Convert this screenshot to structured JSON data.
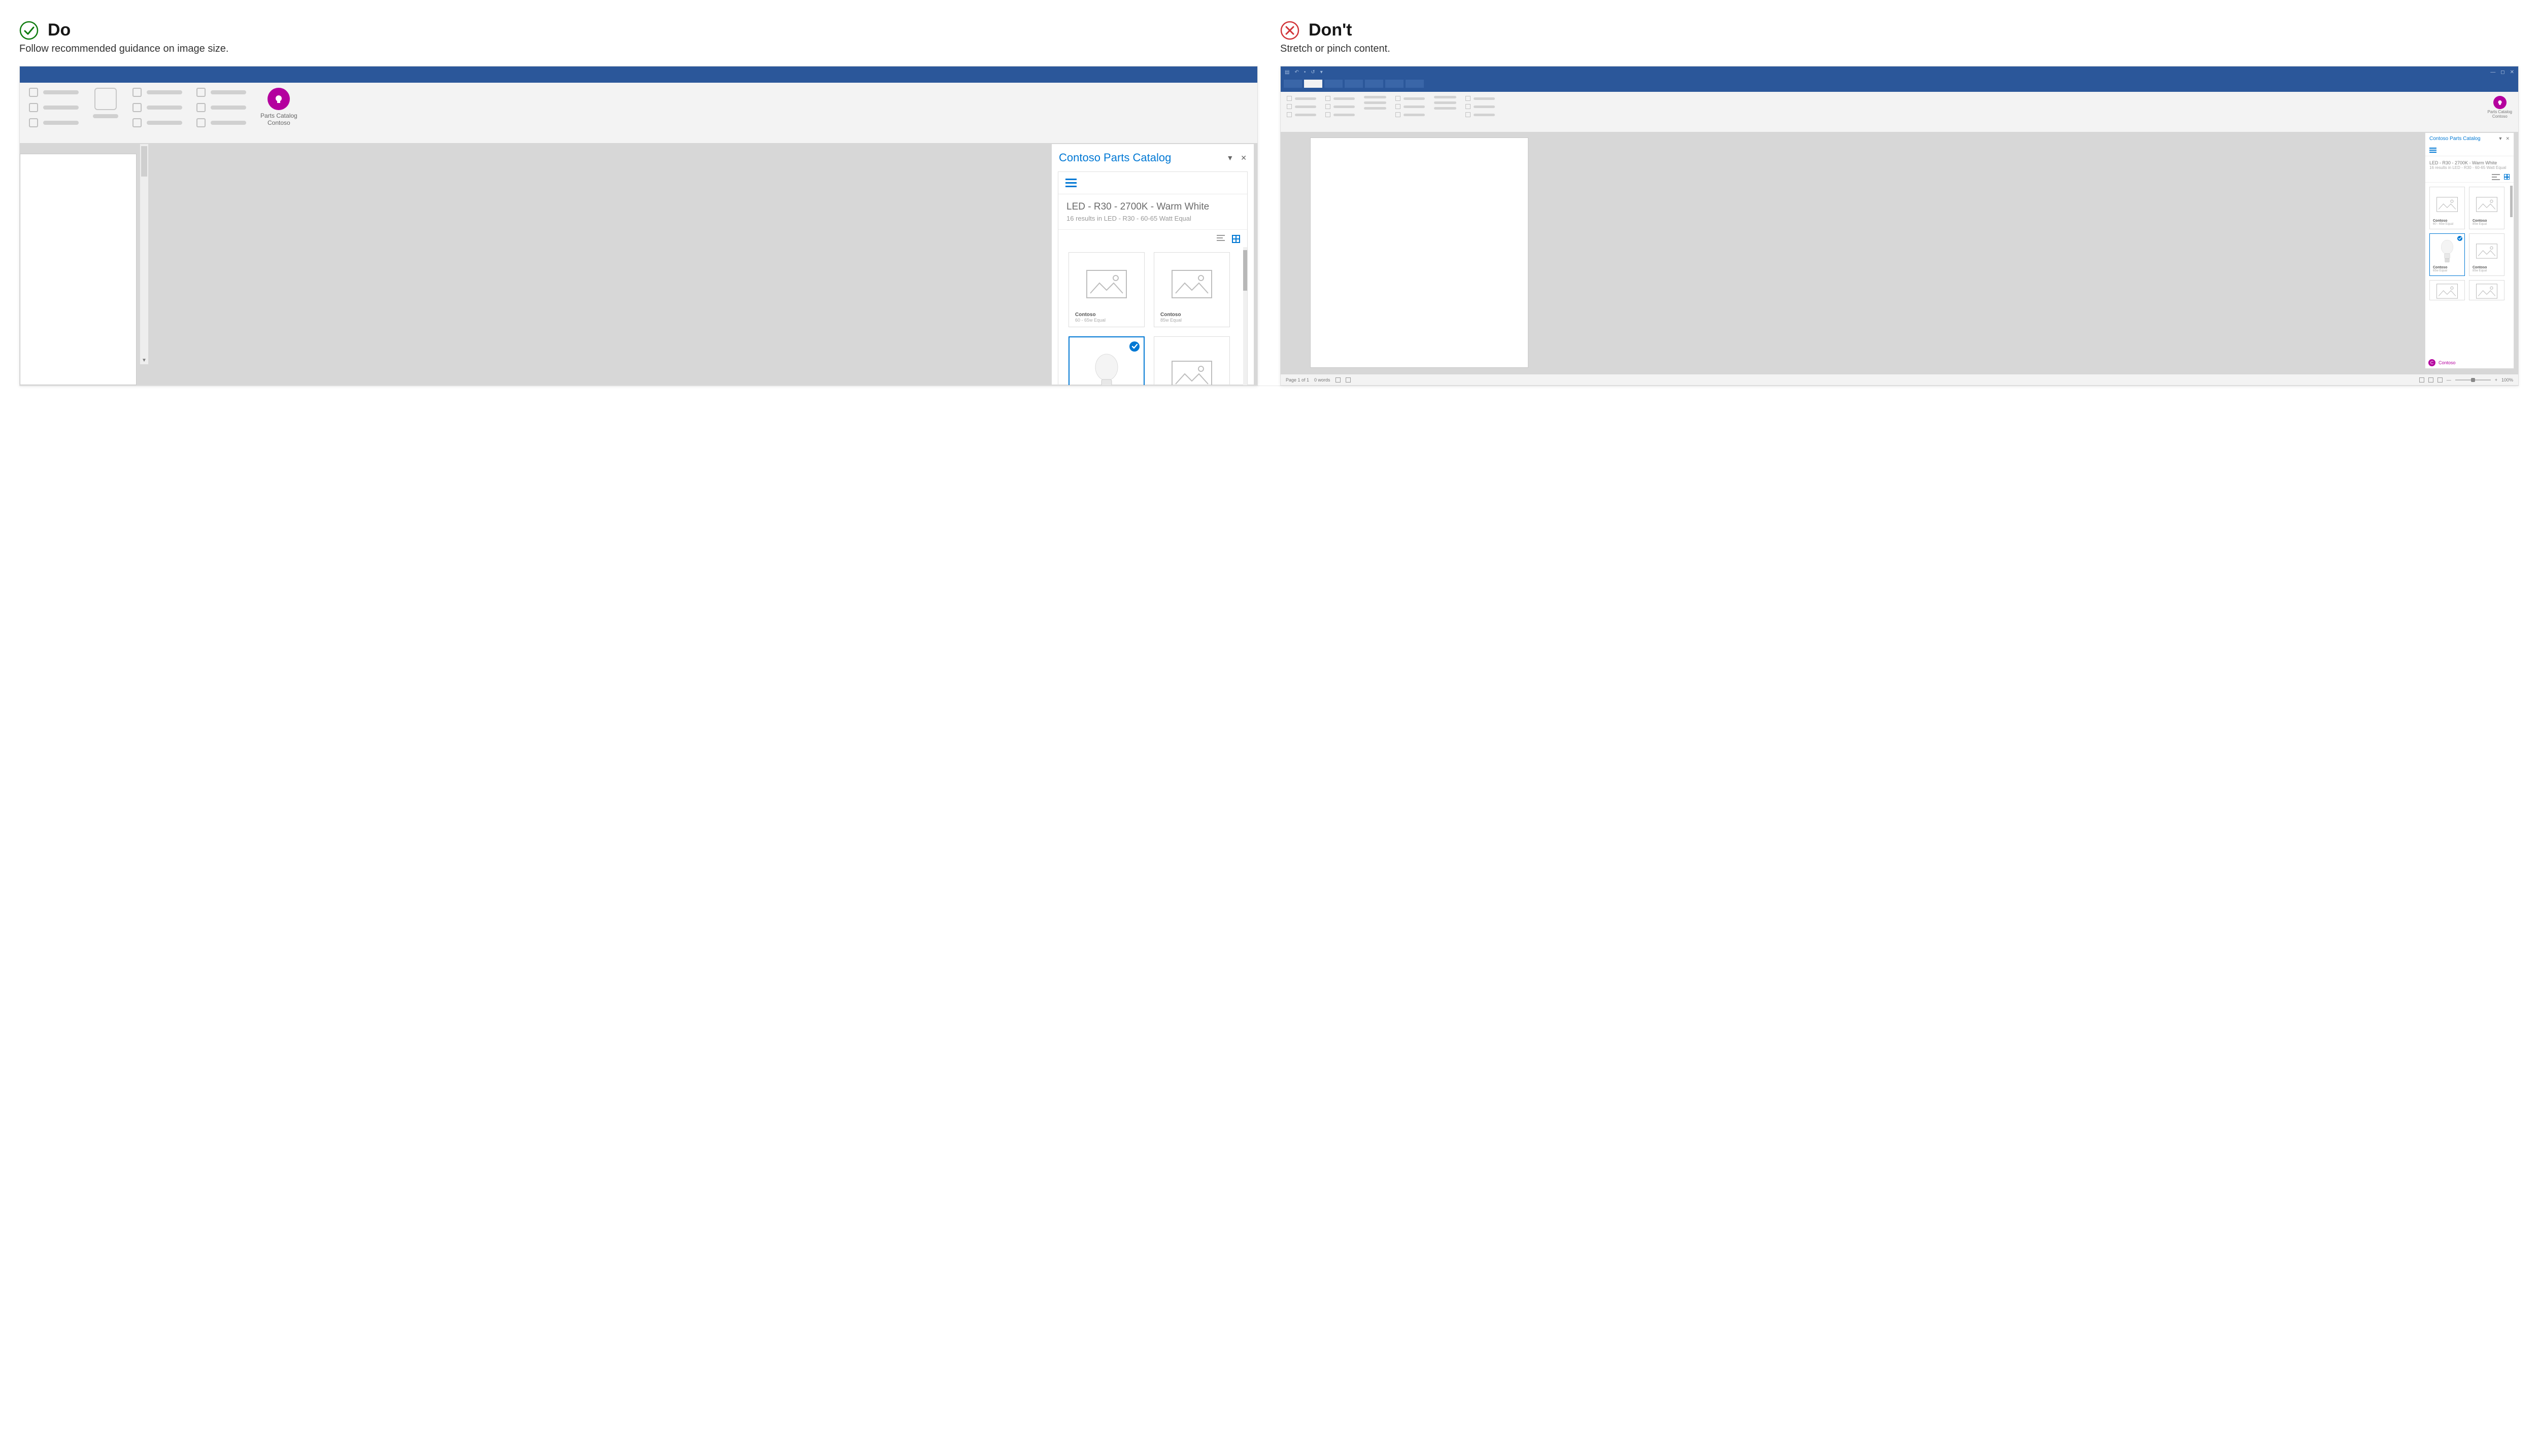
{
  "do": {
    "heading": "Do",
    "caption": "Follow recommended guidance on image size.",
    "addin": {
      "label_line1": "Parts Catalog",
      "label_line2": "Contoso"
    },
    "pane": {
      "title": "Contoso Parts Catalog",
      "breadcrumb_main": "LED - R30 - 2700K - Warm White",
      "breadcrumb_sub": "16 results in LED - R30 - 60-65 Watt Equal",
      "products": [
        {
          "brand": "Contoso",
          "sub": "60 - 65w Equal"
        },
        {
          "brand": "Contoso",
          "sub": "85w Equal"
        }
      ]
    }
  },
  "dont": {
    "heading": "Don't",
    "caption": "Stretch or pinch content.",
    "addin": {
      "label_line1": "Parts Catalog",
      "label_line2": "Contoso"
    },
    "status": {
      "page": "Page 1 of 1",
      "words": "0 words",
      "zoom": "100%"
    },
    "pane": {
      "title": "Contoso Parts Catalog",
      "breadcrumb_main": "LED - R30 - 2700K - Warm White",
      "breadcrumb_sub": "16 results in LED - R30 - 60-65 Watt Equal",
      "products": [
        {
          "brand": "Contoso",
          "sub": "60 - 65w Equal"
        },
        {
          "brand": "Contoso",
          "sub": "85w Equal"
        },
        {
          "brand": "Contoso",
          "sub": "65w Equal"
        },
        {
          "brand": "Contoso",
          "sub": "85w Equal"
        }
      ],
      "footer_brand": "Contoso"
    }
  }
}
